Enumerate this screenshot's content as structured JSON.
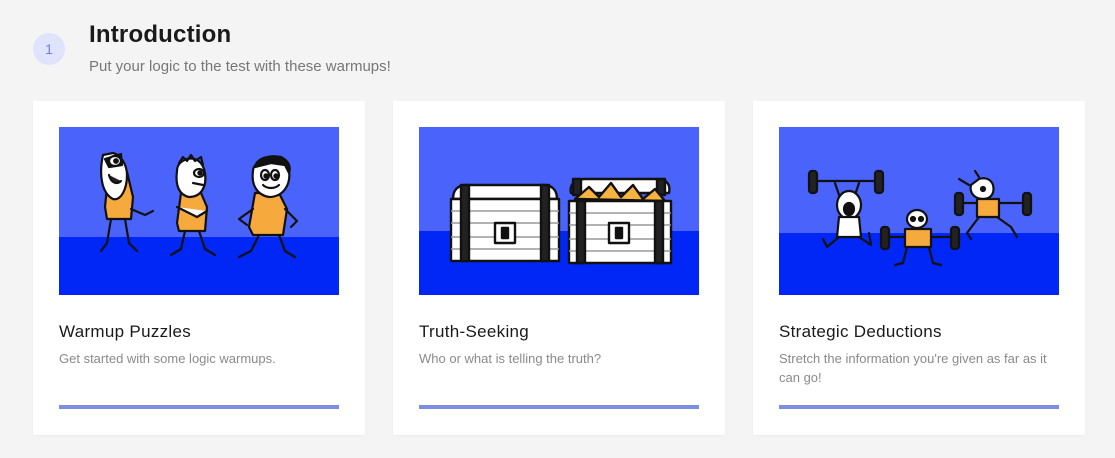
{
  "section": {
    "step_number": "1",
    "title": "Introduction",
    "subtitle": "Put your logic to the test with these warmups!"
  },
  "colors": {
    "sky": "#4a63fb",
    "ground": "#0027f6",
    "progress": "#7b8ee3",
    "badge_bg": "#dfe3fb"
  },
  "cards": [
    {
      "title": "Warmup Puzzles",
      "description": "Get started with some logic warmups.",
      "illustration": "three-cavemen",
      "progress": 1.0
    },
    {
      "title": "Truth-Seeking",
      "description": "Who or what is telling the truth?",
      "illustration": "treasure-chests",
      "progress": 1.0
    },
    {
      "title": "Strategic Deductions",
      "description": "Stretch the information you're given as far as it can go!",
      "illustration": "weightlifters",
      "progress": 1.0
    }
  ]
}
